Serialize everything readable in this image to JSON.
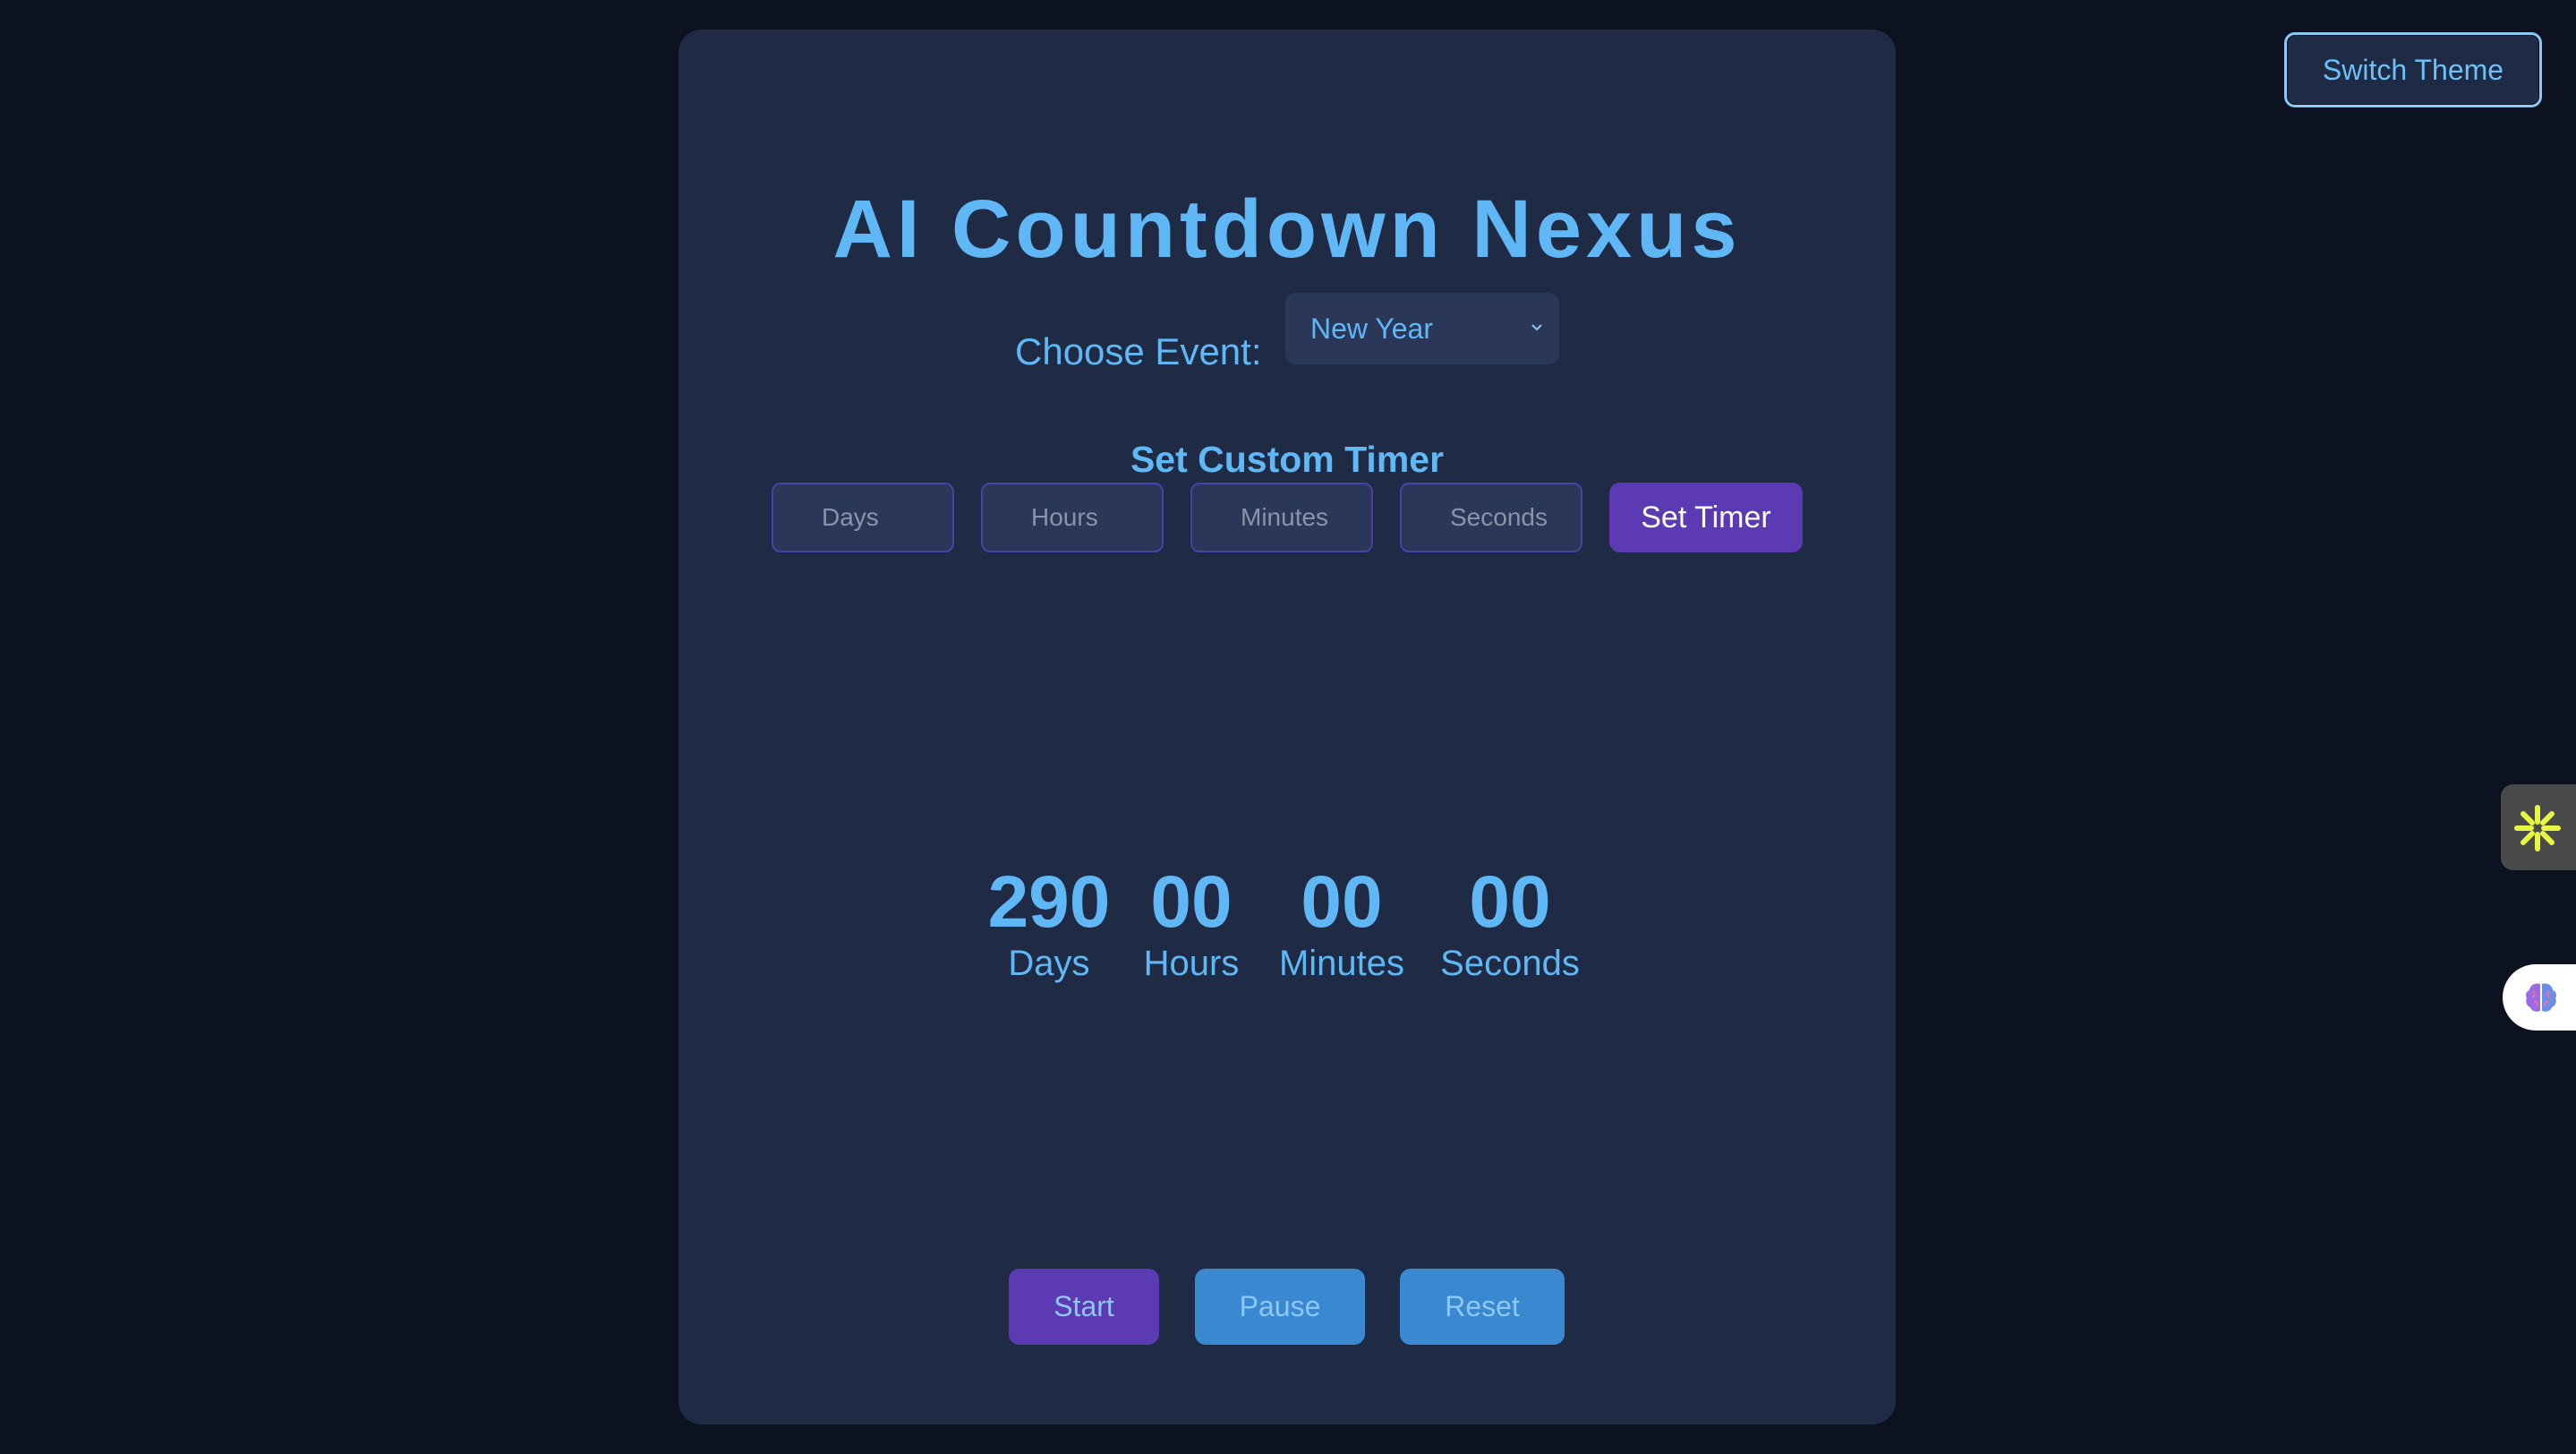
{
  "header": {
    "switch_theme_label": "Switch Theme"
  },
  "app": {
    "title": "AI Countdown Nexus"
  },
  "event": {
    "label": "Choose Event:",
    "selected": "New Year"
  },
  "custom_timer": {
    "heading": "Set Custom Timer",
    "days_placeholder": "Days",
    "hours_placeholder": "Hours",
    "minutes_placeholder": "Minutes",
    "seconds_placeholder": "Seconds",
    "set_label": "Set Timer"
  },
  "countdown": {
    "days": {
      "value": "290",
      "label": "Days"
    },
    "hours": {
      "value": "00",
      "label": "Hours"
    },
    "minutes": {
      "value": "00",
      "label": "Minutes"
    },
    "seconds": {
      "value": "00",
      "label": "Seconds"
    }
  },
  "controls": {
    "start_label": "Start",
    "pause_label": "Pause",
    "reset_label": "Reset"
  },
  "colors": {
    "background": "#0c1220",
    "card": "#1f2a44",
    "accent": "#5fb8f5",
    "purple": "#5b3ab3",
    "blue_button": "#3a88d0"
  },
  "icons": {
    "side_widget_1": "sparkle-asterisk-icon",
    "side_widget_2": "brain-icon"
  }
}
